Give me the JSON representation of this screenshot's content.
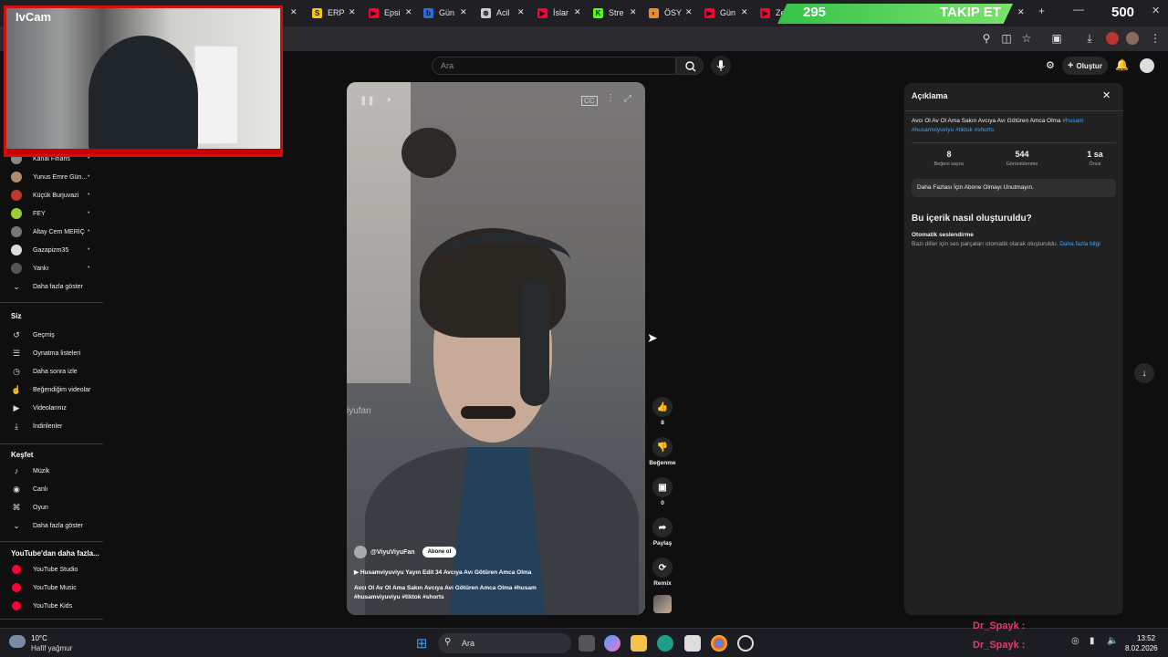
{
  "overlay": {
    "webcam_label": "IvCam",
    "follow_count": "295",
    "follow_label": "TAKIP ET",
    "follow_target": "500",
    "donors": [
      "Dr_Spayk :",
      "Dr_Spayk :"
    ]
  },
  "tabs": [
    {
      "label": "ERP",
      "icon": "S",
      "color": "#f5c518"
    },
    {
      "label": "Epsi",
      "icon": "▶",
      "color": "#ff0033"
    },
    {
      "label": "Gün",
      "icon": "b",
      "color": "#2d6cdf"
    },
    {
      "label": "Acil",
      "icon": "⊛",
      "color": "#cccccc"
    },
    {
      "label": "İslar",
      "icon": "▶",
      "color": "#ff0033"
    },
    {
      "label": "Stre",
      "icon": "K",
      "color": "#53fc18"
    },
    {
      "label": "ÖSY",
      "icon": "◐",
      "color": "#f08a24"
    },
    {
      "label": "Gün",
      "icon": "▶",
      "color": "#ff0033"
    },
    {
      "label": "Zev",
      "icon": "▶",
      "color": "#ff0033"
    }
  ],
  "header": {
    "search_placeholder": "Ara",
    "create_label": "Oluştur"
  },
  "sidebar": {
    "subscriptions": [
      {
        "label": "Kanal Finans",
        "color": "#888"
      },
      {
        "label": "Yunus Emre Gün...",
        "color": "#b08a6a"
      },
      {
        "label": "Küçük Burjuvazi",
        "color": "#c0392b"
      },
      {
        "label": "FEY",
        "color": "#9acd32"
      },
      {
        "label": "Altay Cem MERİÇ",
        "color": "#777"
      },
      {
        "label": "Gazapizm35",
        "color": "#ddd"
      },
      {
        "label": "Yankı",
        "color": "#555"
      }
    ],
    "show_more": "Daha fazla göster",
    "you_heading": "Siz",
    "you_items": [
      {
        "label": "Geçmiş",
        "icon": "↺"
      },
      {
        "label": "Oynatma listeleri",
        "icon": "☰"
      },
      {
        "label": "Daha sonra izle",
        "icon": "◷"
      },
      {
        "label": "Beğendiğim videolar",
        "icon": "☝"
      },
      {
        "label": "Videolarınız",
        "icon": "▶"
      },
      {
        "label": "İndirilenler",
        "icon": "⤓"
      }
    ],
    "explore_heading": "Keşfet",
    "explore_items": [
      {
        "label": "Müzik",
        "icon": "♪"
      },
      {
        "label": "Canlı",
        "icon": "◉"
      },
      {
        "label": "Oyun",
        "icon": "⌘"
      },
      {
        "label": "Daha fazla göster",
        "icon": "⌄"
      }
    ],
    "more_heading": "YouTube'dan daha fazla...",
    "more_items": [
      {
        "label": "YouTube Studio"
      },
      {
        "label": "YouTube Music"
      },
      {
        "label": "YouTube Kids"
      }
    ]
  },
  "video": {
    "watermark": "iyufan",
    "channel": "@ViyuViyuFan",
    "subscribe": "Abone ol",
    "playlist": "Husamviyuviyu Yayın Edit 34 Avcıya Avı Götüren Amca Olma",
    "title": "Avcı Ol Av Ol Ama Sakın Avcıya Avı Götüren Amca Olma",
    "title_tags_1": "#husam",
    "title_tags_2": "#husamviyuviyu #tiktok #shorts"
  },
  "actions": {
    "like_count": "8",
    "dislike_label": "Beğenme",
    "comment_count": "0",
    "share_label": "Paylaş",
    "remix_label": "Remix"
  },
  "description": {
    "title": "Açıklama",
    "text": "Avcı Ol Av Ol Ama Sakın Avcıya Avı Götüren Amca Olma",
    "tags_1": "#husam",
    "tags_2": "#husamviyuviyu #tiktok #shorts",
    "stats": [
      {
        "value": "8",
        "label": "Beğeni sayısı"
      },
      {
        "value": "544",
        "label": "Görüntülenme"
      },
      {
        "value": "1 sa",
        "label": "Önce"
      }
    ],
    "sub_note": "Daha Fazlası İçin Abone Olmayı Unutmayın.",
    "how_title": "Bu içerik nasıl oluşturuldu?",
    "how_sub": "Otomatik seslendirme",
    "how_desc": "Bazı diller için ses parçaları otomatik olarak oluşturuldu.",
    "how_link": "Daha fazla bilgi"
  },
  "taskbar": {
    "temp": "10°C",
    "weather": "Hafif yağmur",
    "search": "Ara",
    "time": "13:52",
    "date": "8.02.2026"
  }
}
